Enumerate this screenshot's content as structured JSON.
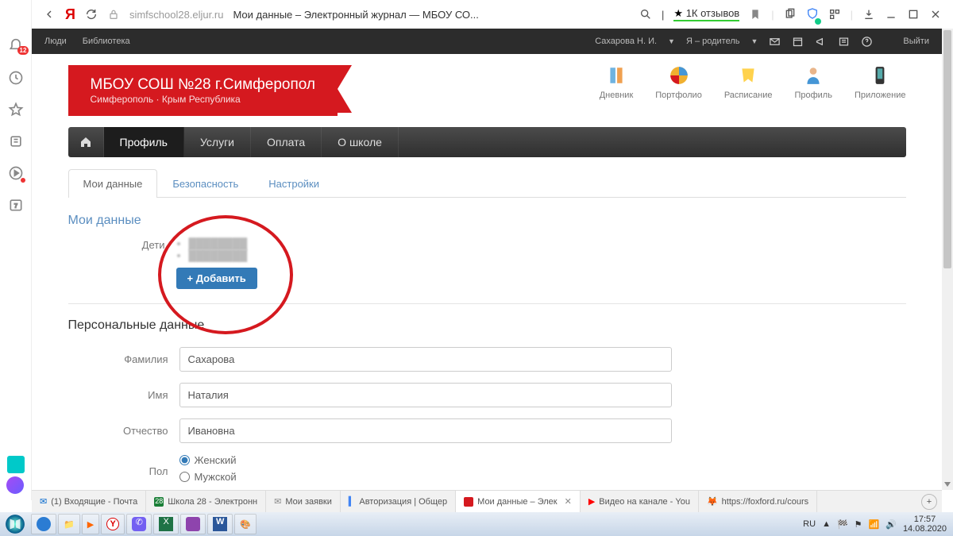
{
  "browser": {
    "url_host": "simfschool28.eljur.ru",
    "title": "Мои данные  – Электронный журнал — МБОУ СО...",
    "reviews": "1К отзывов",
    "sidebar_badge": "12"
  },
  "strip": {
    "left": [
      "Люди",
      "Библиотека"
    ],
    "user": "Сахарова Н. И.",
    "role": "Я – родитель",
    "logout": "Выйти"
  },
  "school": {
    "name": "МБОУ СОШ №28 г.Симферопол",
    "loc": "Симферополь · Крым Республика"
  },
  "right_icons": [
    "Дневник",
    "Портфолио",
    "Расписание",
    "Профиль",
    "Приложение"
  ],
  "tabs": [
    "Профиль",
    "Услуги",
    "Оплата",
    "О школе"
  ],
  "subtabs": [
    "Мои данные",
    "Безопасность",
    "Настройки"
  ],
  "section1": "Мои данные",
  "children_label": "Дети",
  "children": [
    "████████",
    "████████"
  ],
  "add_button": "Добавить",
  "section2": "Персональные данные",
  "form": {
    "last_label": "Фамилия",
    "last": "Сахарова",
    "first_label": "Имя",
    "first": "Наталия",
    "mid_label": "Отчество",
    "mid": "Ивановна",
    "sex_label": "Пол",
    "female": "Женский",
    "male": "Мужской"
  },
  "tabs2": [
    "(1) Входящие - Почта",
    "Школа 28 - Электронн",
    "Мои заявки",
    "Авторизация | Общер",
    "Мои данные  – Элек",
    "Видео на канале - You",
    "https://foxford.ru/cours"
  ],
  "tray": {
    "lang": "RU",
    "time": "17:57",
    "date": "14.08.2020"
  }
}
